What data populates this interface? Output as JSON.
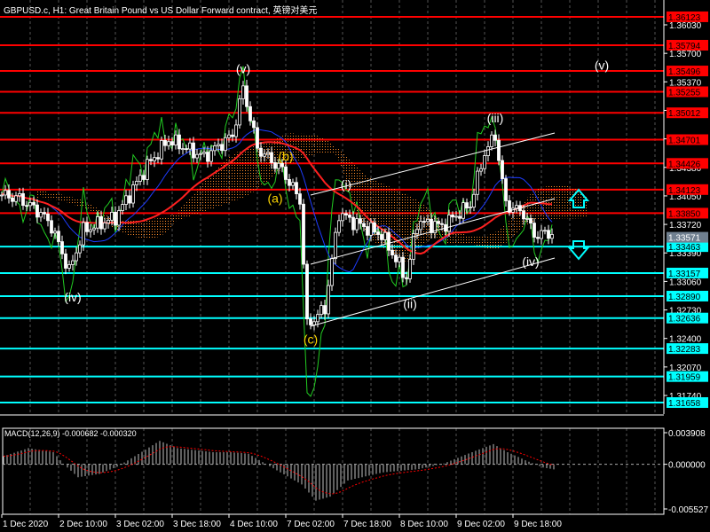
{
  "window": {
    "title": "GBPUSD.c, H1:  Great Britain Pound vs US Dollar Forward contract, 英镑对美元"
  },
  "colors": {
    "background": "#000000",
    "resistance": "#ff0000",
    "support": "#00ffff",
    "current_price_bg": "#708090",
    "wave_labels": "#ffffff",
    "abc_labels": "#ffd700",
    "cloud": "#ff8c28",
    "ma_fast": "#1e3cff",
    "ma_slow": "#ff2020",
    "oscillator": "#22cc22",
    "macd_hist": "#c0c0c0",
    "macd_signal": "#ff0000"
  },
  "chart_data": [
    {
      "type": "candlestick",
      "symbol": "GBPUSD.c",
      "timeframe": "H1",
      "y_ticks": [
        "1.36030",
        "1.35700",
        "1.35370",
        "1.35040",
        "1.34710",
        "1.34380",
        "1.34050",
        "1.33720",
        "1.33390",
        "1.33060",
        "1.32730",
        "1.32400",
        "1.32070",
        "1.31740"
      ],
      "x_ticks": [
        "1 Dec 2020",
        "2 Dec 10:00",
        "3 Dec 02:00",
        "3 Dec 18:00",
        "4 Dec 10:00",
        "7 Dec 02:00",
        "7 Dec 18:00",
        "8 Dec 10:00",
        "9 Dec 02:00",
        "9 Dec 18:00"
      ],
      "resistance_levels": [
        "1.36123",
        "1.35794",
        "1.35496",
        "1.35255",
        "1.35012",
        "1.34701",
        "1.34426",
        "1.34123",
        "1.33850"
      ],
      "support_levels": [
        "1.33463",
        "1.33157",
        "1.32890",
        "1.32636",
        "1.32283",
        "1.31959",
        "1.31658"
      ],
      "current_price": "1.33571",
      "price_path": [
        [
          0,
          1.3406
        ],
        [
          5,
          1.3402
        ],
        [
          11,
          1.3385
        ],
        [
          14,
          1.337
        ],
        [
          19,
          1.3318
        ],
        [
          23,
          1.3365
        ],
        [
          32,
          1.338
        ],
        [
          41,
          1.344
        ],
        [
          47,
          1.347
        ],
        [
          57,
          1.345
        ],
        [
          65,
          1.3475
        ],
        [
          68,
          1.353
        ],
        [
          72,
          1.346
        ],
        [
          79,
          1.3435
        ],
        [
          84,
          1.34
        ],
        [
          86,
          1.3255
        ],
        [
          91,
          1.3275
        ],
        [
          95,
          1.3385
        ],
        [
          99,
          1.3375
        ],
        [
          107,
          1.336
        ],
        [
          114,
          1.331
        ],
        [
          117,
          1.3375
        ],
        [
          124,
          1.337
        ],
        [
          132,
          1.3395
        ],
        [
          136,
          1.3455
        ],
        [
          139,
          1.3475
        ],
        [
          142,
          1.3395
        ],
        [
          147,
          1.3385
        ],
        [
          150,
          1.336
        ],
        [
          155,
          1.3362
        ]
      ],
      "wave_labels": [
        {
          "text": "(v)",
          "bar": 68,
          "price": 1.3547,
          "kind": "wave"
        },
        {
          "text": "(v)",
          "bar": 169,
          "price": 1.3551,
          "kind": "wave"
        },
        {
          "text": "(iii)",
          "bar": 139,
          "price": 1.349,
          "kind": "wave"
        },
        {
          "text": "(i)",
          "bar": 97,
          "price": 1.3413,
          "kind": "wave"
        },
        {
          "text": "(ii)",
          "bar": 115,
          "price": 1.3275,
          "kind": "wave"
        },
        {
          "text": "(iv)",
          "bar": 149,
          "price": 1.3324,
          "kind": "wave"
        },
        {
          "text": "(iv)",
          "bar": 20,
          "price": 1.3283,
          "kind": "wave"
        },
        {
          "text": "(b)",
          "bar": 80,
          "price": 1.3446,
          "kind": "abc"
        },
        {
          "text": "(a)",
          "bar": 77,
          "price": 1.3397,
          "kind": "abc"
        },
        {
          "text": "(c)",
          "bar": 87,
          "price": 1.3234,
          "kind": "abc"
        }
      ]
    },
    {
      "type": "bar",
      "title": "MACD(12,26,9) -0.000682 -0.000320",
      "y_ticks": [
        "0.003908",
        "0.000000",
        "-0.005527"
      ],
      "ylim": [
        -0.005527,
        0.003908
      ],
      "histogram_path": [
        [
          0,
          1.0
        ],
        [
          7,
          2.0
        ],
        [
          14,
          1.5
        ],
        [
          17,
          0
        ],
        [
          21,
          -1.6
        ],
        [
          27,
          -1.2
        ],
        [
          32,
          -0.3
        ],
        [
          37,
          1.0
        ],
        [
          44,
          2.9
        ],
        [
          49,
          2.0
        ],
        [
          59,
          1.5
        ],
        [
          64,
          1.5
        ],
        [
          69,
          1.3
        ],
        [
          74,
          0
        ],
        [
          84,
          -2.5
        ],
        [
          88,
          -4.5
        ],
        [
          92,
          -4.0
        ],
        [
          97,
          -2.0
        ],
        [
          107,
          -1.0
        ],
        [
          117,
          -0.6
        ],
        [
          124,
          0.1
        ],
        [
          132,
          1.5
        ],
        [
          138,
          2.5
        ],
        [
          142,
          1.5
        ],
        [
          147,
          0.5
        ],
        [
          152,
          -0.4
        ],
        [
          156,
          -0.7
        ]
      ],
      "histogram_unit": "1e-3"
    }
  ]
}
